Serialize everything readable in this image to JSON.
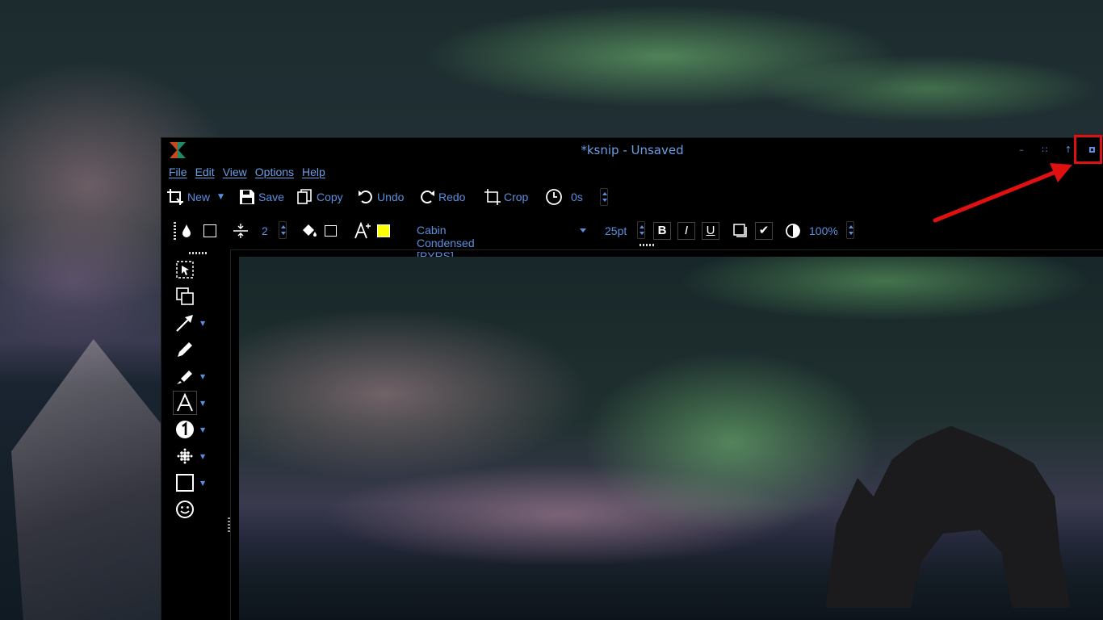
{
  "window": {
    "title": "*ksnip - Unsaved"
  },
  "menubar": {
    "items": [
      "File",
      "Edit",
      "View",
      "Options",
      "Help"
    ]
  },
  "toolbar": {
    "new_label": "New",
    "save_label": "Save",
    "copy_label": "Copy",
    "undo_label": "Undo",
    "redo_label": "Redo",
    "crop_label": "Crop",
    "delay_value": "0s"
  },
  "properties": {
    "width_value": "2",
    "text_color": "#ffff00",
    "font_name": "Cabin Condensed [PYRS]",
    "font_size": "25pt",
    "bold_label": "B",
    "italic_label": "I",
    "underline_label": "U",
    "opacity_value": "100%"
  },
  "sidebar": {
    "tools": [
      "select-icon",
      "duplicate-icon",
      "arrow-icon",
      "pen-icon",
      "marker-icon",
      "text-icon",
      "number-icon",
      "blur-icon",
      "rectangle-icon",
      "sticker-icon"
    ]
  },
  "colors": {
    "accent": "#5a8fdf",
    "annotation_highlight": "#e01010"
  }
}
